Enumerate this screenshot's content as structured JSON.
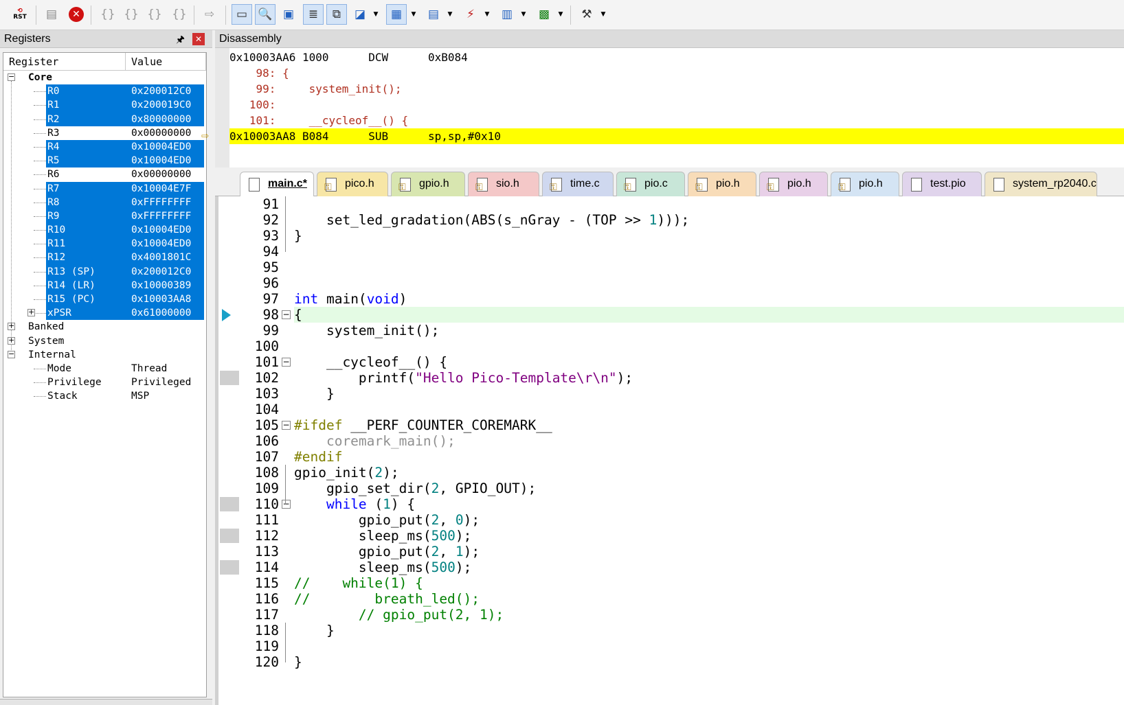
{
  "toolbar": {
    "rst_label": "RST",
    "icons": [
      "reset-icon",
      "step-icon",
      "stop-icon",
      "step-into-icon",
      "step-over-icon",
      "step-out-icon",
      "run-to-cursor-icon",
      "show-next-icon",
      "command-window-icon",
      "disassembly-window-icon",
      "symbols-window-icon",
      "registers-window-icon",
      "call-stack-icon",
      "watch-window-icon",
      "memory-window-icon",
      "serial-window-icon",
      "analysis-window-icon",
      "trace-icon",
      "system-viewer-icon",
      "toolbox-icon"
    ]
  },
  "registers": {
    "title": "Registers",
    "pin": "🖈",
    "close": "✕",
    "col_register": "Register",
    "col_value": "Value",
    "core_label": "Core",
    "core": [
      {
        "name": "R0",
        "value": "0x200012C0",
        "sel": true
      },
      {
        "name": "R1",
        "value": "0x200019C0",
        "sel": true
      },
      {
        "name": "R2",
        "value": "0x80000000",
        "sel": true
      },
      {
        "name": "R3",
        "value": "0x00000000",
        "sel": false
      },
      {
        "name": "R4",
        "value": "0x10004ED0",
        "sel": true
      },
      {
        "name": "R5",
        "value": "0x10004ED0",
        "sel": true
      },
      {
        "name": "R6",
        "value": "0x00000000",
        "sel": false
      },
      {
        "name": "R7",
        "value": "0x10004E7F",
        "sel": true
      },
      {
        "name": "R8",
        "value": "0xFFFFFFFF",
        "sel": true
      },
      {
        "name": "R9",
        "value": "0xFFFFFFFF",
        "sel": true
      },
      {
        "name": "R10",
        "value": "0x10004ED0",
        "sel": true
      },
      {
        "name": "R11",
        "value": "0x10004ED0",
        "sel": true
      },
      {
        "name": "R12",
        "value": "0x4001801C",
        "sel": true
      },
      {
        "name": "R13 (SP)",
        "value": "0x200012C0",
        "sel": true
      },
      {
        "name": "R14 (LR)",
        "value": "0x10000389",
        "sel": true
      },
      {
        "name": "R15 (PC)",
        "value": "0x10003AA8",
        "sel": true
      },
      {
        "name": "xPSR",
        "value": "0x61000000",
        "sel": true
      }
    ],
    "banked": "Banked",
    "system": "System",
    "internal": "Internal",
    "internal_rows": [
      {
        "name": "Mode",
        "value": "Thread"
      },
      {
        "name": "Privilege",
        "value": "Privileged"
      },
      {
        "name": "Stack",
        "value": "MSP"
      }
    ]
  },
  "disassembly": {
    "title": "Disassembly",
    "lines": [
      {
        "text": "0x10003AA6 1000      DCW      0xB084",
        "kind": "asm"
      },
      {
        "text": "    98: {",
        "kind": "src"
      },
      {
        "text": "    99:     system_init();",
        "kind": "src"
      },
      {
        "text": "   100: ",
        "kind": "src"
      },
      {
        "text": "   101:     __cycleof__() {",
        "kind": "src"
      },
      {
        "text": "0x10003AA8 B084      SUB      sp,sp,#0x10",
        "kind": "cur"
      }
    ]
  },
  "tabs": [
    {
      "label": "main.c*",
      "active": true,
      "color": "#ffffff",
      "icon": "file"
    },
    {
      "label": "pico.h",
      "color": "#f7e6a6",
      "icon": "key"
    },
    {
      "label": "gpio.h",
      "color": "#d8e6b0",
      "icon": "key"
    },
    {
      "label": "sio.h",
      "color": "#f4c8c8",
      "icon": "key"
    },
    {
      "label": "time.c",
      "color": "#cfd8ef",
      "icon": "key"
    },
    {
      "label": "pio.c",
      "color": "#c8e6d8",
      "icon": "key"
    },
    {
      "label": "pio.h",
      "color": "#f8dcb8",
      "icon": "key"
    },
    {
      "label": "pio.h",
      "color": "#e8d0e8",
      "icon": "key"
    },
    {
      "label": "pio.h",
      "color": "#d4e4f4",
      "icon": "key"
    },
    {
      "label": "test.pio",
      "color": "#e0d4ec",
      "icon": "file"
    },
    {
      "label": "system_rp2040.c",
      "color": "#f0e6c8",
      "icon": "file"
    }
  ],
  "editor": {
    "lines": [
      {
        "n": "91",
        "html": ""
      },
      {
        "n": "92",
        "html": "    set_led_gradation(ABS(s_nGray - (TOP >> <span class=\"nb\">1</span>)));"
      },
      {
        "n": "93",
        "html": "}"
      },
      {
        "n": "94",
        "html": ""
      },
      {
        "n": "95",
        "html": ""
      },
      {
        "n": "96",
        "html": ""
      },
      {
        "n": "97",
        "html": "<span class=\"kw\">int</span> main(<span class=\"kw\">void</span>)"
      },
      {
        "n": "98",
        "html": "{"
      },
      {
        "n": "99",
        "html": "    system_init();"
      },
      {
        "n": "100",
        "html": ""
      },
      {
        "n": "101",
        "html": "    __cycleof__() {"
      },
      {
        "n": "102",
        "html": "        printf(<span class=\"st\">\"Hello Pico-Template\\r\\n\"</span>);"
      },
      {
        "n": "103",
        "html": "    }"
      },
      {
        "n": "104",
        "html": ""
      },
      {
        "n": "105",
        "html": "<span class=\"pp\">#ifdef</span> __PERF_COUNTER_COREMARK__"
      },
      {
        "n": "106",
        "html": "<span class=\"gy\">    coremark_main();</span>"
      },
      {
        "n": "107",
        "html": "<span class=\"pp\">#endif</span>"
      },
      {
        "n": "108",
        "html": "gpio_init(<span class=\"nb\">2</span>);"
      },
      {
        "n": "109",
        "html": "    gpio_set_dir(<span class=\"nb\">2</span>, GPIO_OUT);"
      },
      {
        "n": "110",
        "html": "    <span class=\"kw\">while</span> (<span class=\"nb\">1</span>) {"
      },
      {
        "n": "111",
        "html": "        gpio_put(<span class=\"nb\">2</span>, <span class=\"nb\">0</span>);"
      },
      {
        "n": "112",
        "html": "        sleep_ms(<span class=\"nb\">500</span>);"
      },
      {
        "n": "113",
        "html": "        gpio_put(<span class=\"nb\">2</span>, <span class=\"nb\">1</span>);"
      },
      {
        "n": "114",
        "html": "        sleep_ms(<span class=\"nb\">500</span>);"
      },
      {
        "n": "115",
        "html": "<span class=\"cm\">//    while(1) {</span>"
      },
      {
        "n": "116",
        "html": "<span class=\"cm\">//        breath_led();</span>"
      },
      {
        "n": "117",
        "html": "<span class=\"cm\">        // gpio_put(2, 1);</span>"
      },
      {
        "n": "118",
        "html": "    }"
      },
      {
        "n": "119",
        "html": ""
      },
      {
        "n": "120",
        "html": "}"
      }
    ]
  }
}
